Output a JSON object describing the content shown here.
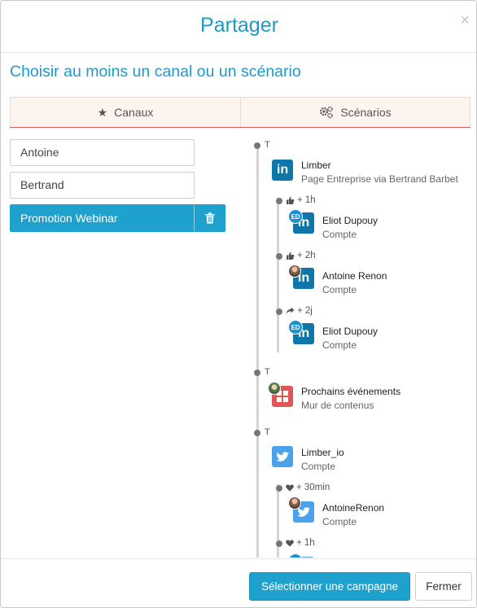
{
  "header": {
    "title": "Partager",
    "close": "×"
  },
  "subtitle": "Choisir au moins un canal ou un scénario",
  "tabs": [
    {
      "label": "Canaux",
      "icon": "star-icon"
    },
    {
      "label": "Scénarios",
      "icon": "gears-icon"
    }
  ],
  "scenarios": [
    {
      "label": "Antoine"
    },
    {
      "label": "Bertrand"
    },
    {
      "label": "Promotion Webinar",
      "selected": true
    }
  ],
  "timeline": {
    "groups": [
      {
        "marker": "T",
        "channel": {
          "network": "linkedin",
          "title": "Limber",
          "subtitle": "Page Entreprise via Bertrand Barbet"
        },
        "actions": [
          {
            "action_icon": "thumbs-up-icon",
            "delay": "+ 1h",
            "network": "linkedin",
            "avatar": "ED",
            "title": "Eliot Dupouy",
            "subtitle": "Compte"
          },
          {
            "action_icon": "thumbs-up-icon",
            "delay": "+ 2h",
            "network": "linkedin",
            "avatar": "photo",
            "title": "Antoine Renon",
            "subtitle": "Compte"
          },
          {
            "action_icon": "share-icon",
            "delay": "+ 2j",
            "network": "linkedin",
            "avatar": "ED",
            "title": "Eliot Dupouy",
            "subtitle": "Compte"
          }
        ]
      },
      {
        "marker": "T",
        "channel": {
          "network": "content-wall",
          "title": "Prochains événements",
          "subtitle": "Mur de contenus"
        },
        "actions": []
      },
      {
        "marker": "T",
        "channel": {
          "network": "twitter",
          "title": "Limber_io",
          "subtitle": "Compte"
        },
        "actions": [
          {
            "action_icon": "heart-icon",
            "delay": "+ 30min",
            "network": "twitter",
            "avatar": "photo",
            "title": "AntoineRenon",
            "subtitle": "Compte"
          },
          {
            "action_icon": "heart-icon",
            "delay": "+ 1h",
            "network": "twitter",
            "avatar": "ED",
            "title": "",
            "subtitle": ""
          }
        ]
      }
    ]
  },
  "footer": {
    "primary_label": "Sélectionner une campagne",
    "close_label": "Fermer"
  },
  "colors": {
    "accent": "#1ea1cd",
    "title": "#1e9ac7",
    "tab_underline": "#e05a5a",
    "linkedin": "#0e76a8",
    "twitter": "#4aa1ec",
    "content_wall": "#e05555"
  }
}
